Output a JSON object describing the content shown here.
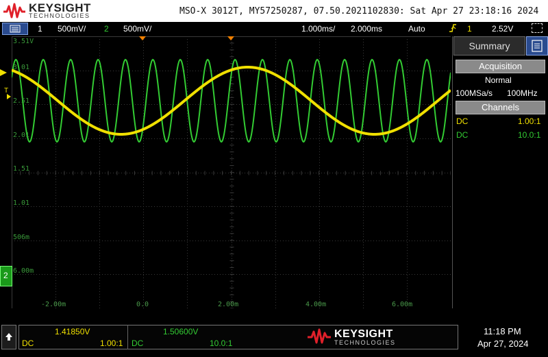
{
  "header": {
    "brand": "KEYSIGHT",
    "brand_sub": "TECHNOLOGIES",
    "scope_info": "MSO-X 3012T, MY57250287, 07.50.2021102830: Sat Apr 27 23:18:16 2024"
  },
  "status": {
    "ch1_num": "1",
    "ch1_scale": "500mV/",
    "ch2_num": "2",
    "ch2_scale": "500mV/",
    "time_delay": "1.000ms/",
    "time_scale": "2.000ms",
    "trigger_mode": "Auto",
    "trigger_source": "1",
    "trigger_level": "2.52V"
  },
  "graticule": {
    "y_labels": [
      "3.51V",
      "3.01",
      "2.51",
      "2.01",
      "1.51",
      "1.01",
      "506m",
      "6.00m"
    ],
    "x_labels": [
      "-2.00m",
      "0.0",
      "2.00m",
      "4.00m",
      "6.00m"
    ],
    "trigger_marker": "T",
    "ch2_ground_marker": "2"
  },
  "colors": {
    "ch1": "#f0e000",
    "ch2": "#33cc33",
    "grid": "#3a3a3a",
    "accent_blue": "#2a4b8f"
  },
  "panel": {
    "tab_label": "Summary",
    "acq_title": "Acquisition",
    "acq_mode": "Normal",
    "sample_rate": "100MSa/s",
    "bandwidth": "100MHz",
    "channels_title": "Channels",
    "ch1_coupling": "DC",
    "ch1_probe": "1.00:1",
    "ch2_coupling": "DC",
    "ch2_probe": "10.0:1"
  },
  "measurements": {
    "ch1_value": "1.41850V",
    "ch1_coupling": "DC",
    "ch1_probe": "1.00:1",
    "ch2_value": "1.50600V",
    "ch2_coupling": "DC",
    "ch2_probe": "10.0:1"
  },
  "footer": {
    "brand": "KEYSIGHT",
    "brand_sub": "TECHNOLOGIES",
    "time": "11:18 PM",
    "date": "Apr 27, 2024"
  },
  "icons": {
    "menu": "menu-icon",
    "trigger": "trigger-edge-icon",
    "dots": "touch-off-icon",
    "panel": "panel-icon",
    "up": "up-arrow-icon"
  }
}
